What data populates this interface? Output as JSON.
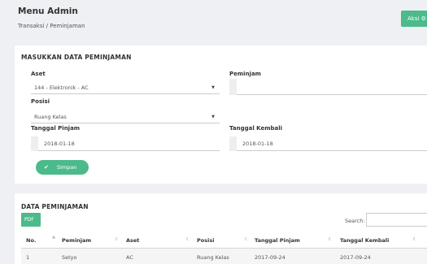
{
  "header": {
    "title": "Menu Admin",
    "breadcrumb": "Transaksi / Peminjaman",
    "action_label": "Aksi ⚙"
  },
  "form": {
    "section_title": "MASUKKAN DATA PEMINJAMAN",
    "aset_label": "Aset",
    "aset_value": "144 - Elektronik - AC",
    "peminjam_label": "Peminjam",
    "peminjam_value": "",
    "posisi_label": "Posisi",
    "posisi_value": "Ruang Kelas",
    "tanggal_pinjam_label": "Tanggal Pinjam",
    "tanggal_pinjam_value": "2018-01-18",
    "tanggal_kembali_label": "Tanggal Kembali",
    "tanggal_kembali_value": "2018-01-18",
    "save_label": "Simpan"
  },
  "table": {
    "section_title": "DATA PEMINJAMAN",
    "pdf_label": "PDF",
    "search_label": "Search:",
    "search_value": "",
    "columns": [
      "No.",
      "Peminjam",
      "Aset",
      "Posisi",
      "Tanggal Pinjam",
      "Tanggal Kembali"
    ],
    "rows": [
      [
        "1",
        "Setyo",
        "AC",
        "Ruang Kelas",
        "2017-09-24",
        "2017-09-24"
      ]
    ]
  },
  "colors": {
    "accent": "#4cba8b",
    "background": "#eef0f3"
  },
  "icons": {
    "caret": "caret-down-icon",
    "check": "check-icon",
    "sort": "sort-icon",
    "gear": "gear-icon"
  }
}
